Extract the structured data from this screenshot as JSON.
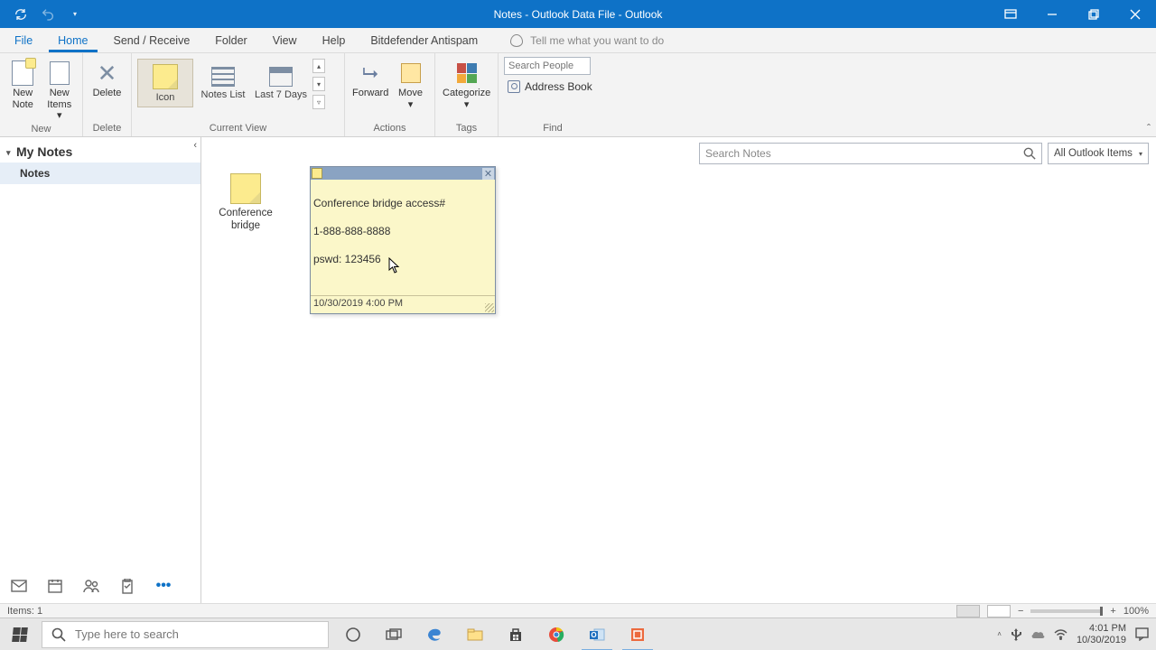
{
  "window": {
    "title": "Notes - Outlook Data File  -  Outlook"
  },
  "menu": {
    "tabs": [
      "File",
      "Home",
      "Send / Receive",
      "Folder",
      "View",
      "Help",
      "Bitdefender Antispam"
    ],
    "active_index": 1,
    "tellme": "Tell me what you want to do"
  },
  "ribbon": {
    "new": {
      "label": "New",
      "new_note": "New\nNote",
      "new_items": "New\nItems ▾"
    },
    "delete": {
      "label": "Delete",
      "btn": "Delete"
    },
    "current_view": {
      "label": "Current View",
      "icon": "Icon",
      "notes_list": "Notes List",
      "last7": "Last 7 Days"
    },
    "actions": {
      "label": "Actions",
      "forward": "Forward",
      "move": "Move\n▾"
    },
    "tags": {
      "label": "Tags",
      "categorize": "Categorize\n▾"
    },
    "find": {
      "label": "Find",
      "search_placeholder": "Search People",
      "address_book": "Address Book"
    }
  },
  "sidebar": {
    "header": "My Notes",
    "folders": [
      "Notes"
    ]
  },
  "search": {
    "placeholder": "Search Notes",
    "scope": "All Outlook Items"
  },
  "notes": {
    "items": [
      {
        "name": "Conference bridge"
      }
    ]
  },
  "sticky_note": {
    "line1": "Conference bridge access#",
    "line2": "1-888-888-8888",
    "line3": "pswd: 123456",
    "timestamp": "10/30/2019 4:00 PM"
  },
  "statusbar": {
    "items": "Items: 1",
    "zoom": "100%"
  },
  "taskbar": {
    "search_placeholder": "Type here to search",
    "time": "4:01 PM",
    "date": "10/30/2019"
  }
}
